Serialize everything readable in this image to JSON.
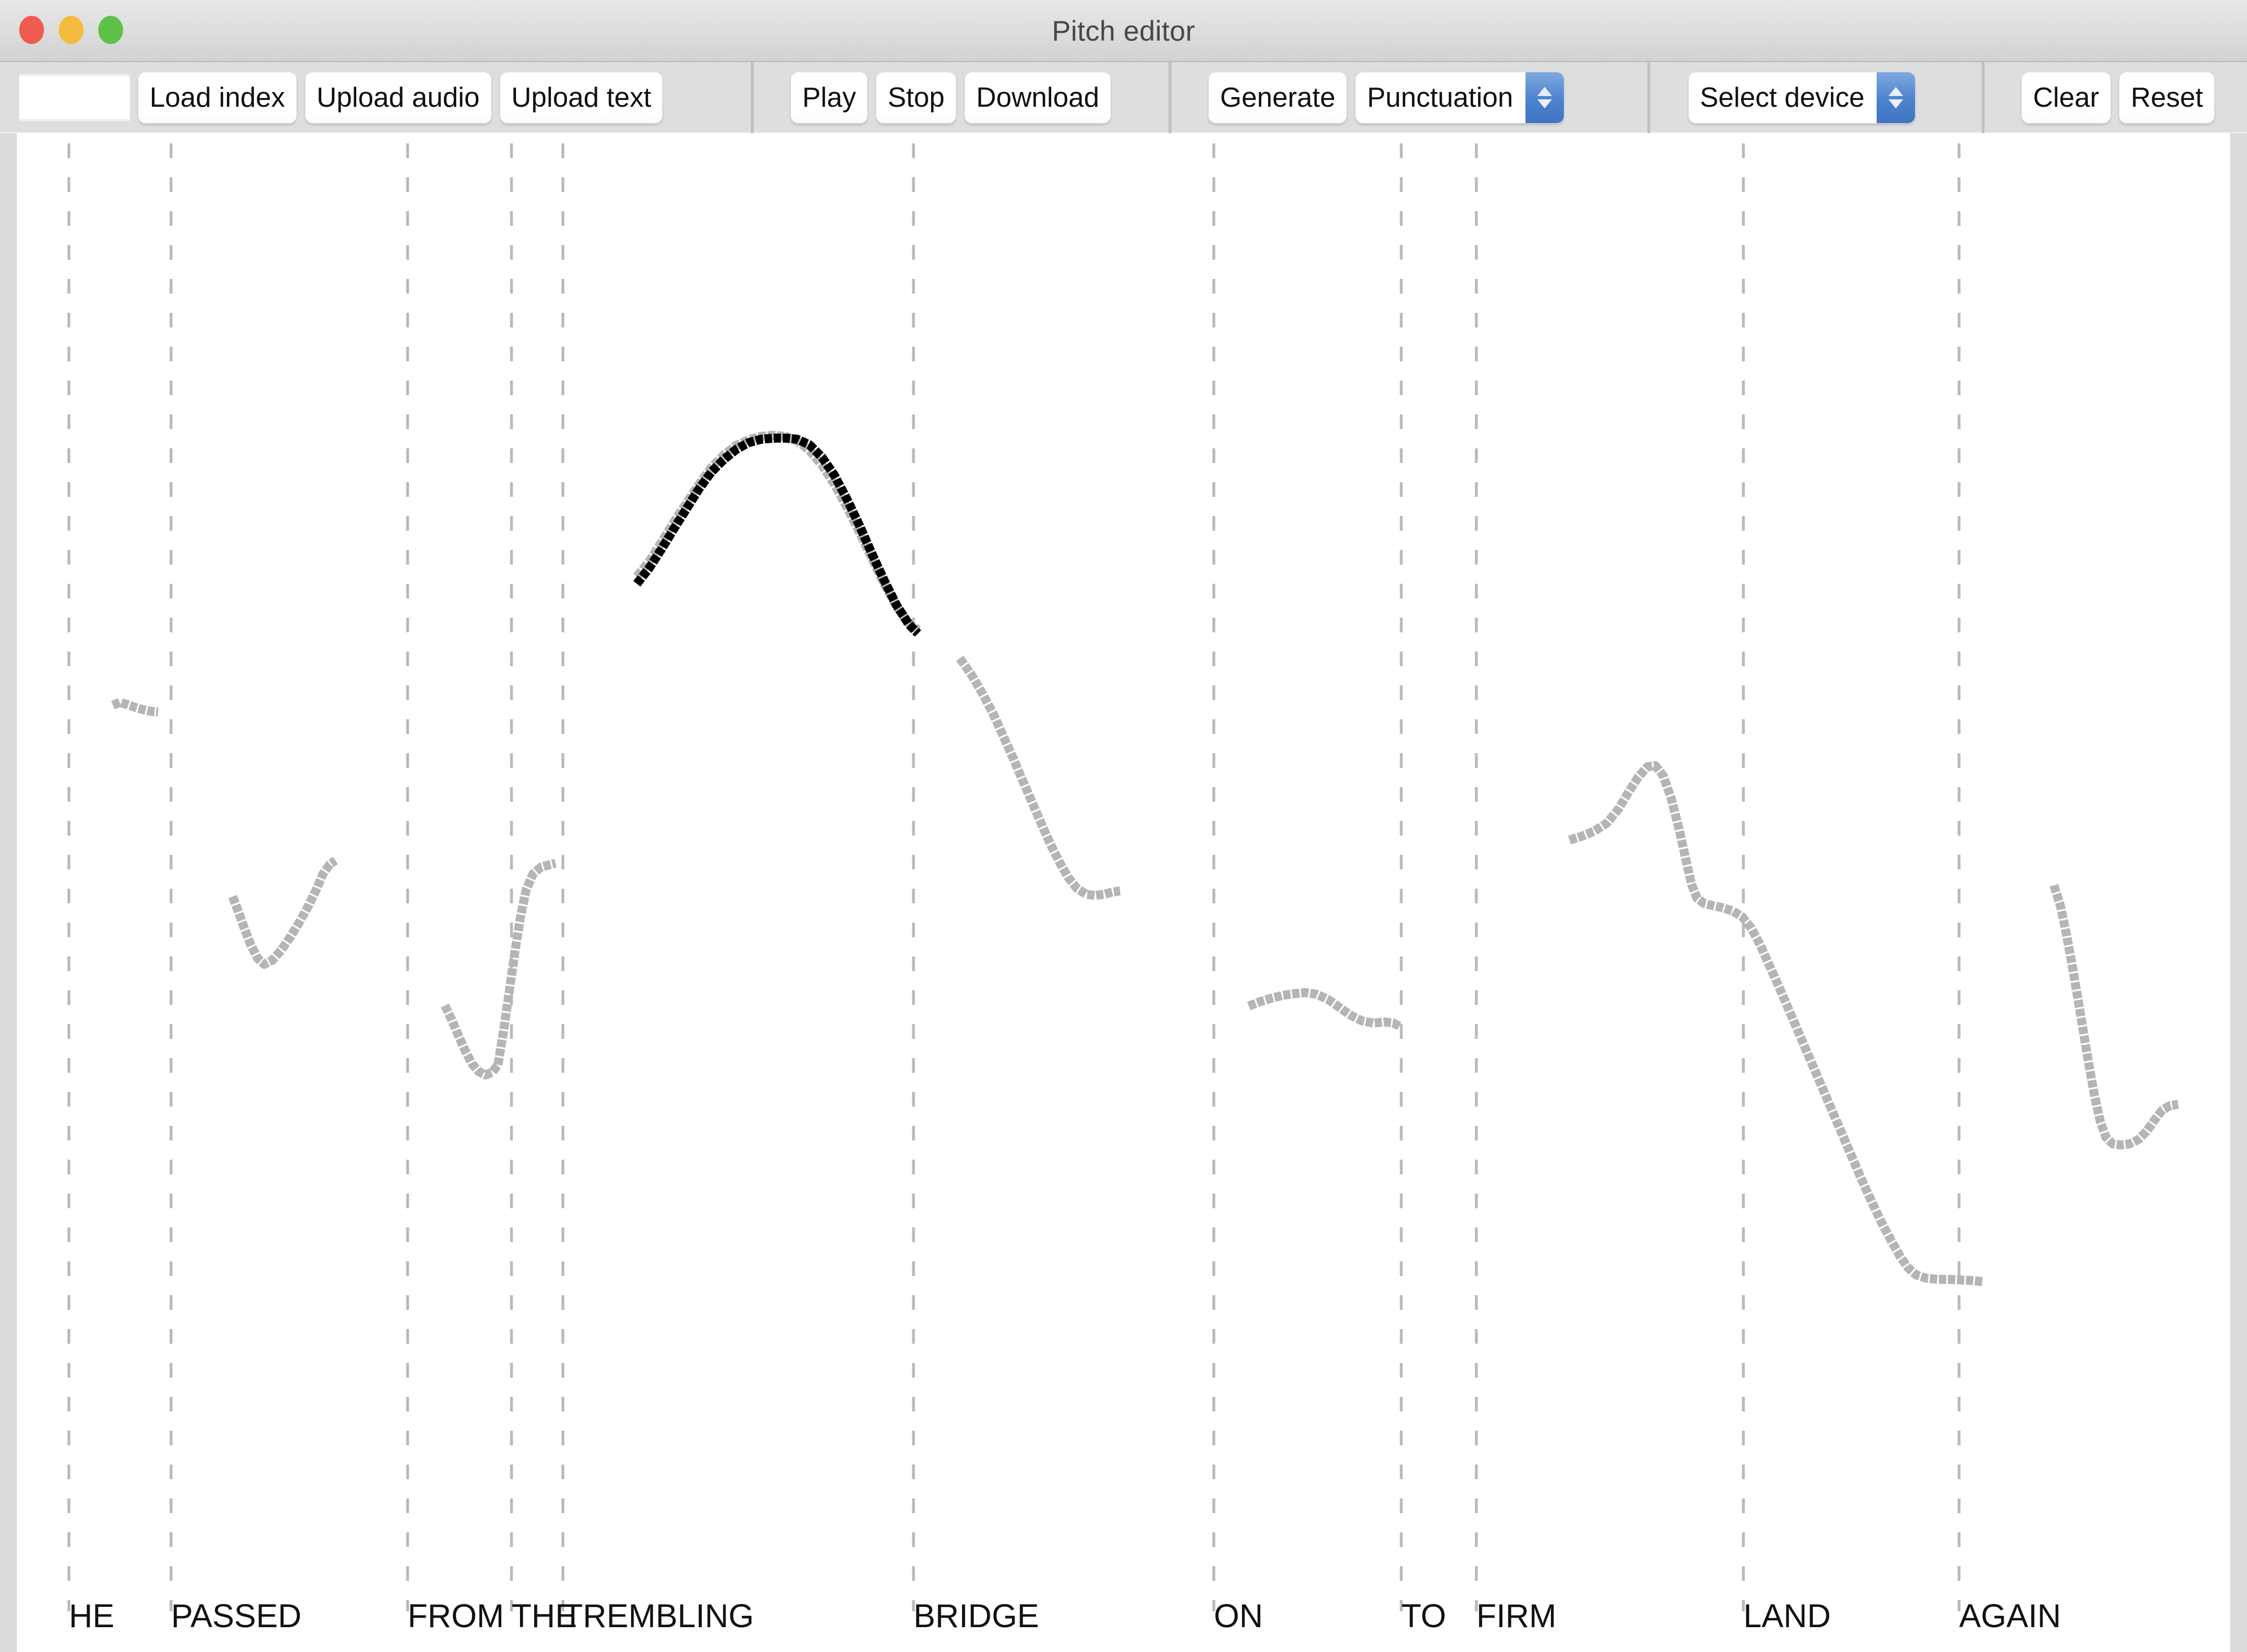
{
  "window": {
    "title": "Pitch editor",
    "traffic_lights": [
      "close",
      "minimize",
      "zoom"
    ]
  },
  "toolbar": {
    "index_input": {
      "value": "",
      "placeholder": ""
    },
    "load_index_label": "Load index",
    "upload_audio_label": "Upload audio",
    "upload_text_label": "Upload text",
    "play_label": "Play",
    "stop_label": "Stop",
    "download_label": "Download",
    "generate_label": "Generate",
    "punctuation_select": {
      "value": "Punctuation"
    },
    "device_select": {
      "value": "Select device"
    },
    "clear_label": "Clear",
    "reset_label": "Reset"
  },
  "chart_data": {
    "type": "line",
    "title": "",
    "xlabel": "",
    "ylabel": "",
    "grid": true,
    "legend_position": "none",
    "colors": {
      "original_contour": "#b5b5b5",
      "edited_contour": "#000000",
      "gridline": "#b9b9b9",
      "background": "#ffffff",
      "label_text": "#111111"
    },
    "word_labels": [
      {
        "text": "HE",
        "x": 62
      },
      {
        "text": "PASSED",
        "x": 243
      },
      {
        "text": "FROM",
        "x": 662
      },
      {
        "text": "THE",
        "x": 846
      },
      {
        "text": "TREMBLING",
        "x": 937
      },
      {
        "text": "BRIDGE",
        "x": 1558
      },
      {
        "text": "ON",
        "x": 2090
      },
      {
        "text": "TO",
        "x": 2422
      },
      {
        "text": "FIRM",
        "x": 2555
      },
      {
        "text": "LAND",
        "x": 3028
      },
      {
        "text": "AGAIN",
        "x": 3410
      }
    ],
    "gridlines_x": [
      62,
      243,
      662,
      846,
      937,
      1558,
      2090,
      2422,
      2555,
      3028,
      3410
    ],
    "series": [
      {
        "name": "original_pitch_contour",
        "color": "#b5b5b5",
        "segments": [
          [
            [
              140,
              1013
            ],
            [
              152,
              1008
            ],
            [
              166,
              1012
            ],
            [
              180,
              1017
            ],
            [
              194,
              1021
            ],
            [
              208,
              1024
            ],
            [
              220,
              1025
            ]
          ],
          [
            [
              352,
              1352
            ],
            [
              362,
              1378
            ],
            [
              372,
              1406
            ],
            [
              384,
              1437
            ],
            [
              396,
              1461
            ],
            [
              408,
              1472
            ],
            [
              422,
              1465
            ],
            [
              438,
              1447
            ],
            [
              454,
              1424
            ],
            [
              470,
              1398
            ],
            [
              486,
              1369
            ],
            [
              500,
              1340
            ],
            [
              512,
              1312
            ],
            [
              524,
              1295
            ],
            [
              534,
              1288
            ]
          ],
          [
            [
              728,
              1545
            ],
            [
              740,
              1570
            ],
            [
              752,
              1598
            ],
            [
              764,
              1625
            ],
            [
              776,
              1648
            ],
            [
              788,
              1662
            ],
            [
              800,
              1668
            ],
            [
              812,
              1663
            ],
            [
              822,
              1650
            ]
          ],
          [
            [
              822,
              1650
            ],
            [
              832,
              1590
            ],
            [
              842,
              1520
            ],
            [
              852,
              1450
            ],
            [
              862,
              1388
            ],
            [
              872,
              1340
            ],
            [
              884,
              1312
            ],
            [
              898,
              1300
            ],
            [
              912,
              1296
            ],
            [
              924,
              1293
            ]
          ],
          [
            [
              1068,
              785
            ],
            [
              1090,
              758
            ],
            [
              1112,
              724
            ],
            [
              1134,
              688
            ],
            [
              1156,
              655
            ],
            [
              1178,
              622
            ],
            [
              1200,
              592
            ],
            [
              1222,
              570
            ],
            [
              1244,
              553
            ],
            [
              1266,
              543
            ],
            [
              1288,
              537
            ],
            [
              1310,
              535
            ],
            [
              1332,
              537
            ],
            [
              1352,
              545
            ],
            [
              1374,
              562
            ],
            [
              1396,
              588
            ],
            [
              1418,
              622
            ],
            [
              1440,
              662
            ],
            [
              1462,
              706
            ],
            [
              1484,
              752
            ],
            [
              1506,
              798
            ],
            [
              1528,
              838
            ],
            [
              1550,
              868
            ],
            [
              1566,
              880
            ]
          ],
          [
            [
              1640,
              930
            ],
            [
              1660,
              958
            ],
            [
              1680,
              992
            ],
            [
              1700,
              1030
            ],
            [
              1718,
              1070
            ],
            [
              1736,
              1110
            ],
            [
              1752,
              1148
            ],
            [
              1768,
              1185
            ],
            [
              1784,
              1222
            ],
            [
              1800,
              1258
            ],
            [
              1816,
              1290
            ],
            [
              1832,
              1318
            ],
            [
              1848,
              1338
            ],
            [
              1864,
              1348
            ],
            [
              1880,
              1350
            ],
            [
              1896,
              1348
            ],
            [
              1910,
              1344
            ],
            [
              1924,
              1342
            ]
          ],
          [
            [
              2152,
              1546
            ],
            [
              2172,
              1538
            ],
            [
              2192,
              1532
            ],
            [
              2212,
              1527
            ],
            [
              2232,
              1524
            ],
            [
              2252,
              1522
            ],
            [
              2272,
              1525
            ],
            [
              2292,
              1534
            ],
            [
              2312,
              1548
            ],
            [
              2332,
              1562
            ],
            [
              2352,
              1572
            ],
            [
              2372,
              1576
            ],
            [
              2392,
              1574
            ],
            [
              2408,
              1576
            ],
            [
              2420,
              1582
            ]
          ],
          [
            [
              2720,
              1252
            ],
            [
              2742,
              1245
            ],
            [
              2764,
              1236
            ],
            [
              2786,
              1222
            ],
            [
              2806,
              1198
            ],
            [
              2824,
              1168
            ],
            [
              2842,
              1140
            ],
            [
              2858,
              1122
            ],
            [
              2872,
              1120
            ],
            [
              2886,
              1138
            ],
            [
              2900,
              1178
            ],
            [
              2914,
              1232
            ],
            [
              2926,
              1286
            ],
            [
              2936,
              1330
            ],
            [
              2946,
              1355
            ],
            [
              2958,
              1364
            ],
            [
              2974,
              1368
            ],
            [
              2992,
              1372
            ],
            [
              3010,
              1378
            ],
            [
              3026,
              1388
            ],
            [
              3042,
              1408
            ],
            [
              3058,
              1438
            ],
            [
              3074,
              1474
            ],
            [
              3092,
              1514
            ],
            [
              3110,
              1556
            ],
            [
              3128,
              1598
            ],
            [
              3146,
              1640
            ],
            [
              3164,
              1682
            ],
            [
              3182,
              1724
            ],
            [
              3200,
              1766
            ],
            [
              3218,
              1808
            ],
            [
              3236,
              1850
            ],
            [
              3254,
              1890
            ],
            [
              3272,
              1928
            ],
            [
              3290,
              1962
            ],
            [
              3306,
              1990
            ],
            [
              3320,
              2010
            ],
            [
              3334,
              2022
            ],
            [
              3352,
              2028
            ],
            [
              3372,
              2030
            ],
            [
              3392,
              2030
            ],
            [
              3412,
              2031
            ],
            [
              3432,
              2032
            ],
            [
              3452,
              2034
            ]
          ],
          [
            [
              3578,
              1332
            ],
            [
              3590,
              1370
            ],
            [
              3600,
              1418
            ],
            [
              3610,
              1472
            ],
            [
              3620,
              1530
            ],
            [
              3630,
              1590
            ],
            [
              3640,
              1650
            ],
            [
              3650,
              1705
            ],
            [
              3660,
              1750
            ],
            [
              3670,
              1778
            ],
            [
              3682,
              1790
            ],
            [
              3696,
              1792
            ],
            [
              3712,
              1790
            ],
            [
              3728,
              1782
            ],
            [
              3742,
              1768
            ],
            [
              3756,
              1748
            ],
            [
              3770,
              1730
            ],
            [
              3784,
              1722
            ],
            [
              3798,
              1720
            ]
          ]
        ]
      },
      {
        "name": "edited_pitch_contour",
        "color": "#000000",
        "segments": [
          [
            [
              1068,
              798
            ],
            [
              1090,
              770
            ],
            [
              1112,
              736
            ],
            [
              1134,
              700
            ],
            [
              1156,
              665
            ],
            [
              1178,
              630
            ],
            [
              1200,
              600
            ],
            [
              1222,
              578
            ],
            [
              1244,
              560
            ],
            [
              1266,
              548
            ],
            [
              1288,
              542
            ],
            [
              1310,
              540
            ],
            [
              1332,
              540
            ],
            [
              1352,
              542
            ],
            [
              1374,
              552
            ],
            [
              1396,
              574
            ],
            [
              1418,
              606
            ],
            [
              1440,
              648
            ],
            [
              1462,
              694
            ],
            [
              1484,
              744
            ],
            [
              1506,
              792
            ],
            [
              1528,
              836
            ],
            [
              1550,
              870
            ],
            [
              1566,
              886
            ]
          ]
        ]
      }
    ]
  }
}
